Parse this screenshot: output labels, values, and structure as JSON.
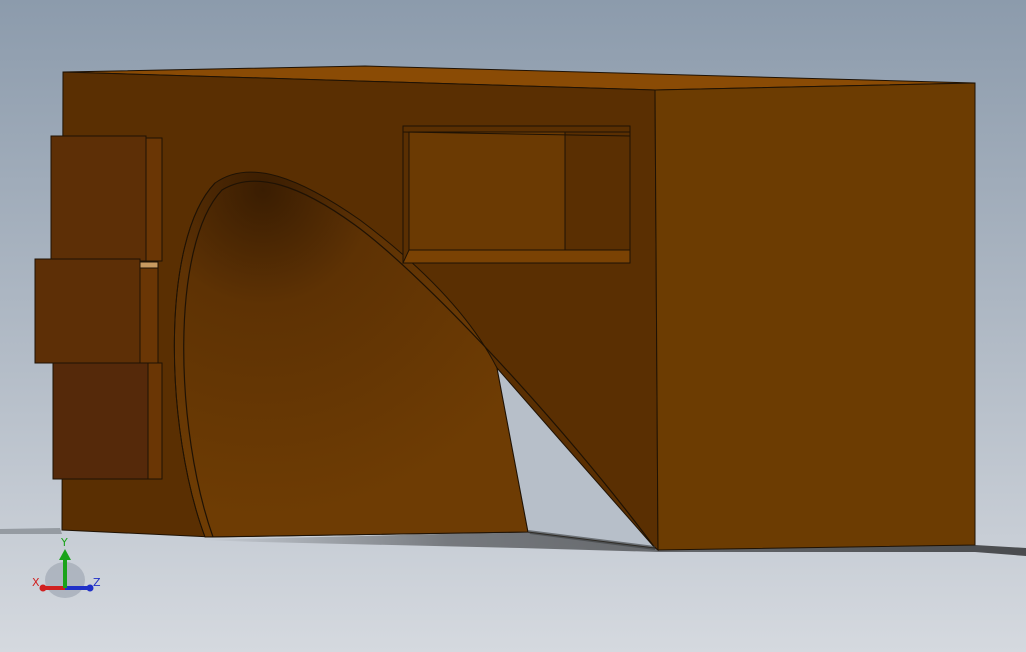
{
  "viewport": {
    "background_top": "#8d9cad",
    "background_bottom": "#d4d8de",
    "model_color": "#6b3a08",
    "model_front_face": "#5b3002",
    "model_side_face": "#6c3c02",
    "model_top_face": "#8a4b05",
    "model_panel_light": "#6d3b04",
    "model_panel_dark": "#55290a",
    "edge_color": "#1f1204"
  },
  "triad": {
    "x_label": "X",
    "y_label": "Y",
    "z_label": "Z",
    "x_color": "#d02020",
    "y_color": "#1aa31a",
    "z_color": "#2030c8"
  }
}
